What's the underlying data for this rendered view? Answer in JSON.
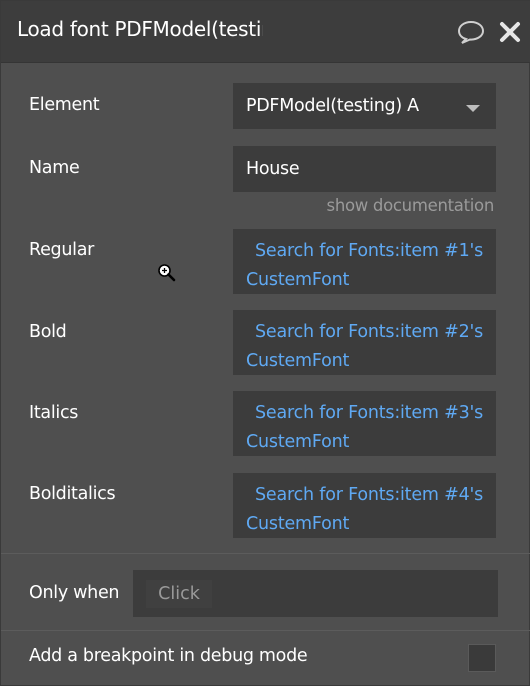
{
  "header": {
    "title": "Load font PDFModel(testing) A"
  },
  "fields": {
    "element": {
      "label": "Element",
      "value": "PDFModel(testing) A"
    },
    "name": {
      "label": "Name",
      "value": "House"
    },
    "documentation_link": "show documentation",
    "regular": {
      "label": "Regular",
      "value": "Search for Fonts:item #1's CustemFont"
    },
    "bold": {
      "label": "Bold",
      "value": "Search for Fonts:item #2's CustemFont"
    },
    "italics": {
      "label": "Italics",
      "value": "Search for Fonts:item #3's CustemFont"
    },
    "bolditalics": {
      "label": "Bolditalics",
      "value": "Search for Fonts:item #4's CustemFont"
    }
  },
  "footer": {
    "only_when_label": "Only when",
    "only_when_placeholder": "Click",
    "breakpoint_label": "Add a breakpoint in debug mode"
  },
  "icons": {
    "comment": "speech-bubble-icon",
    "close": "close-icon",
    "dropdown": "chevron-down-icon",
    "cursor": "magnifier-cursor-icon"
  },
  "colors": {
    "panel_bg": "#4f4f4f",
    "titlebar_bg": "#3d3d3d",
    "field_bg": "#3c3c3c",
    "dynamic_text": "#5fa9f3",
    "muted_text": "#9a9a9a"
  }
}
